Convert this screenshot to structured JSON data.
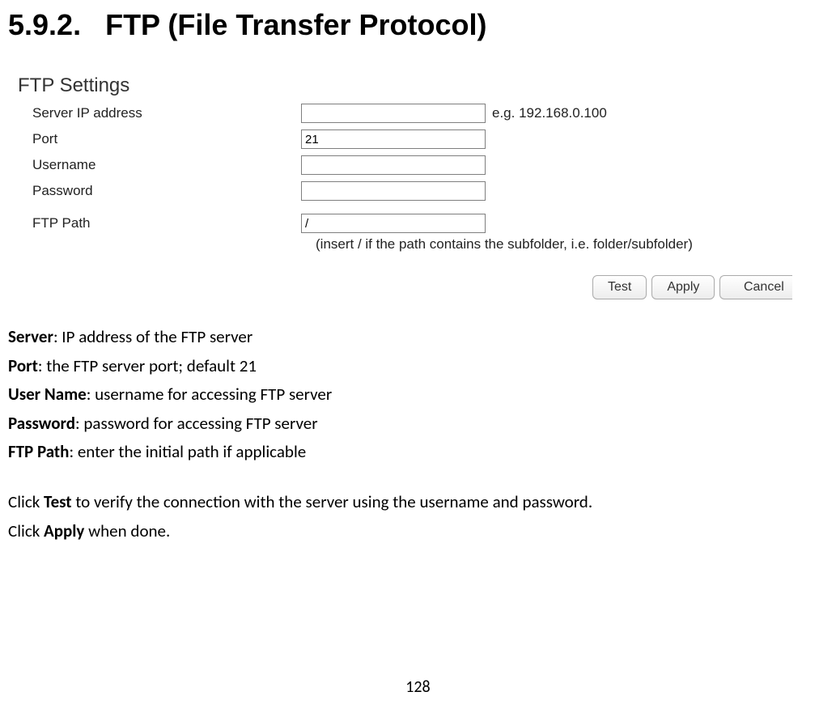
{
  "heading": {
    "number": "5.9.2.",
    "title": "FTP (File Transfer Protocol)"
  },
  "panel": {
    "title": "FTP Settings",
    "rows": {
      "server": {
        "label": "Server IP address",
        "value": "",
        "hint": "e.g. 192.168.0.100"
      },
      "port": {
        "label": "Port",
        "value": "21"
      },
      "username": {
        "label": "Username",
        "value": ""
      },
      "password": {
        "label": "Password",
        "value": ""
      },
      "ftppath": {
        "label": "FTP Path",
        "value": "/",
        "note": "(insert / if the path contains the subfolder, i.e. folder/subfolder)"
      }
    },
    "buttons": {
      "test": "Test",
      "apply": "Apply",
      "cancel": "Cancel"
    }
  },
  "desc": {
    "server_b": "Server",
    "server_t": ": IP address of the FTP server",
    "port_b": "Port",
    "port_t": ": the FTP server port; default 21",
    "user_b": "User Name",
    "user_t": ": username for accessing FTP server",
    "pass_b": "Password",
    "pass_t": ": password for accessing FTP server",
    "path_b": "FTP Path",
    "path_t": ": enter the initial path if applicable",
    "click1_a": "Click ",
    "click1_b": "Test",
    "click1_c": " to verify the connection with the server using the username and password.",
    "click2_a": "Click ",
    "click2_b": "Apply",
    "click2_c": " when done."
  },
  "page_number": "128"
}
